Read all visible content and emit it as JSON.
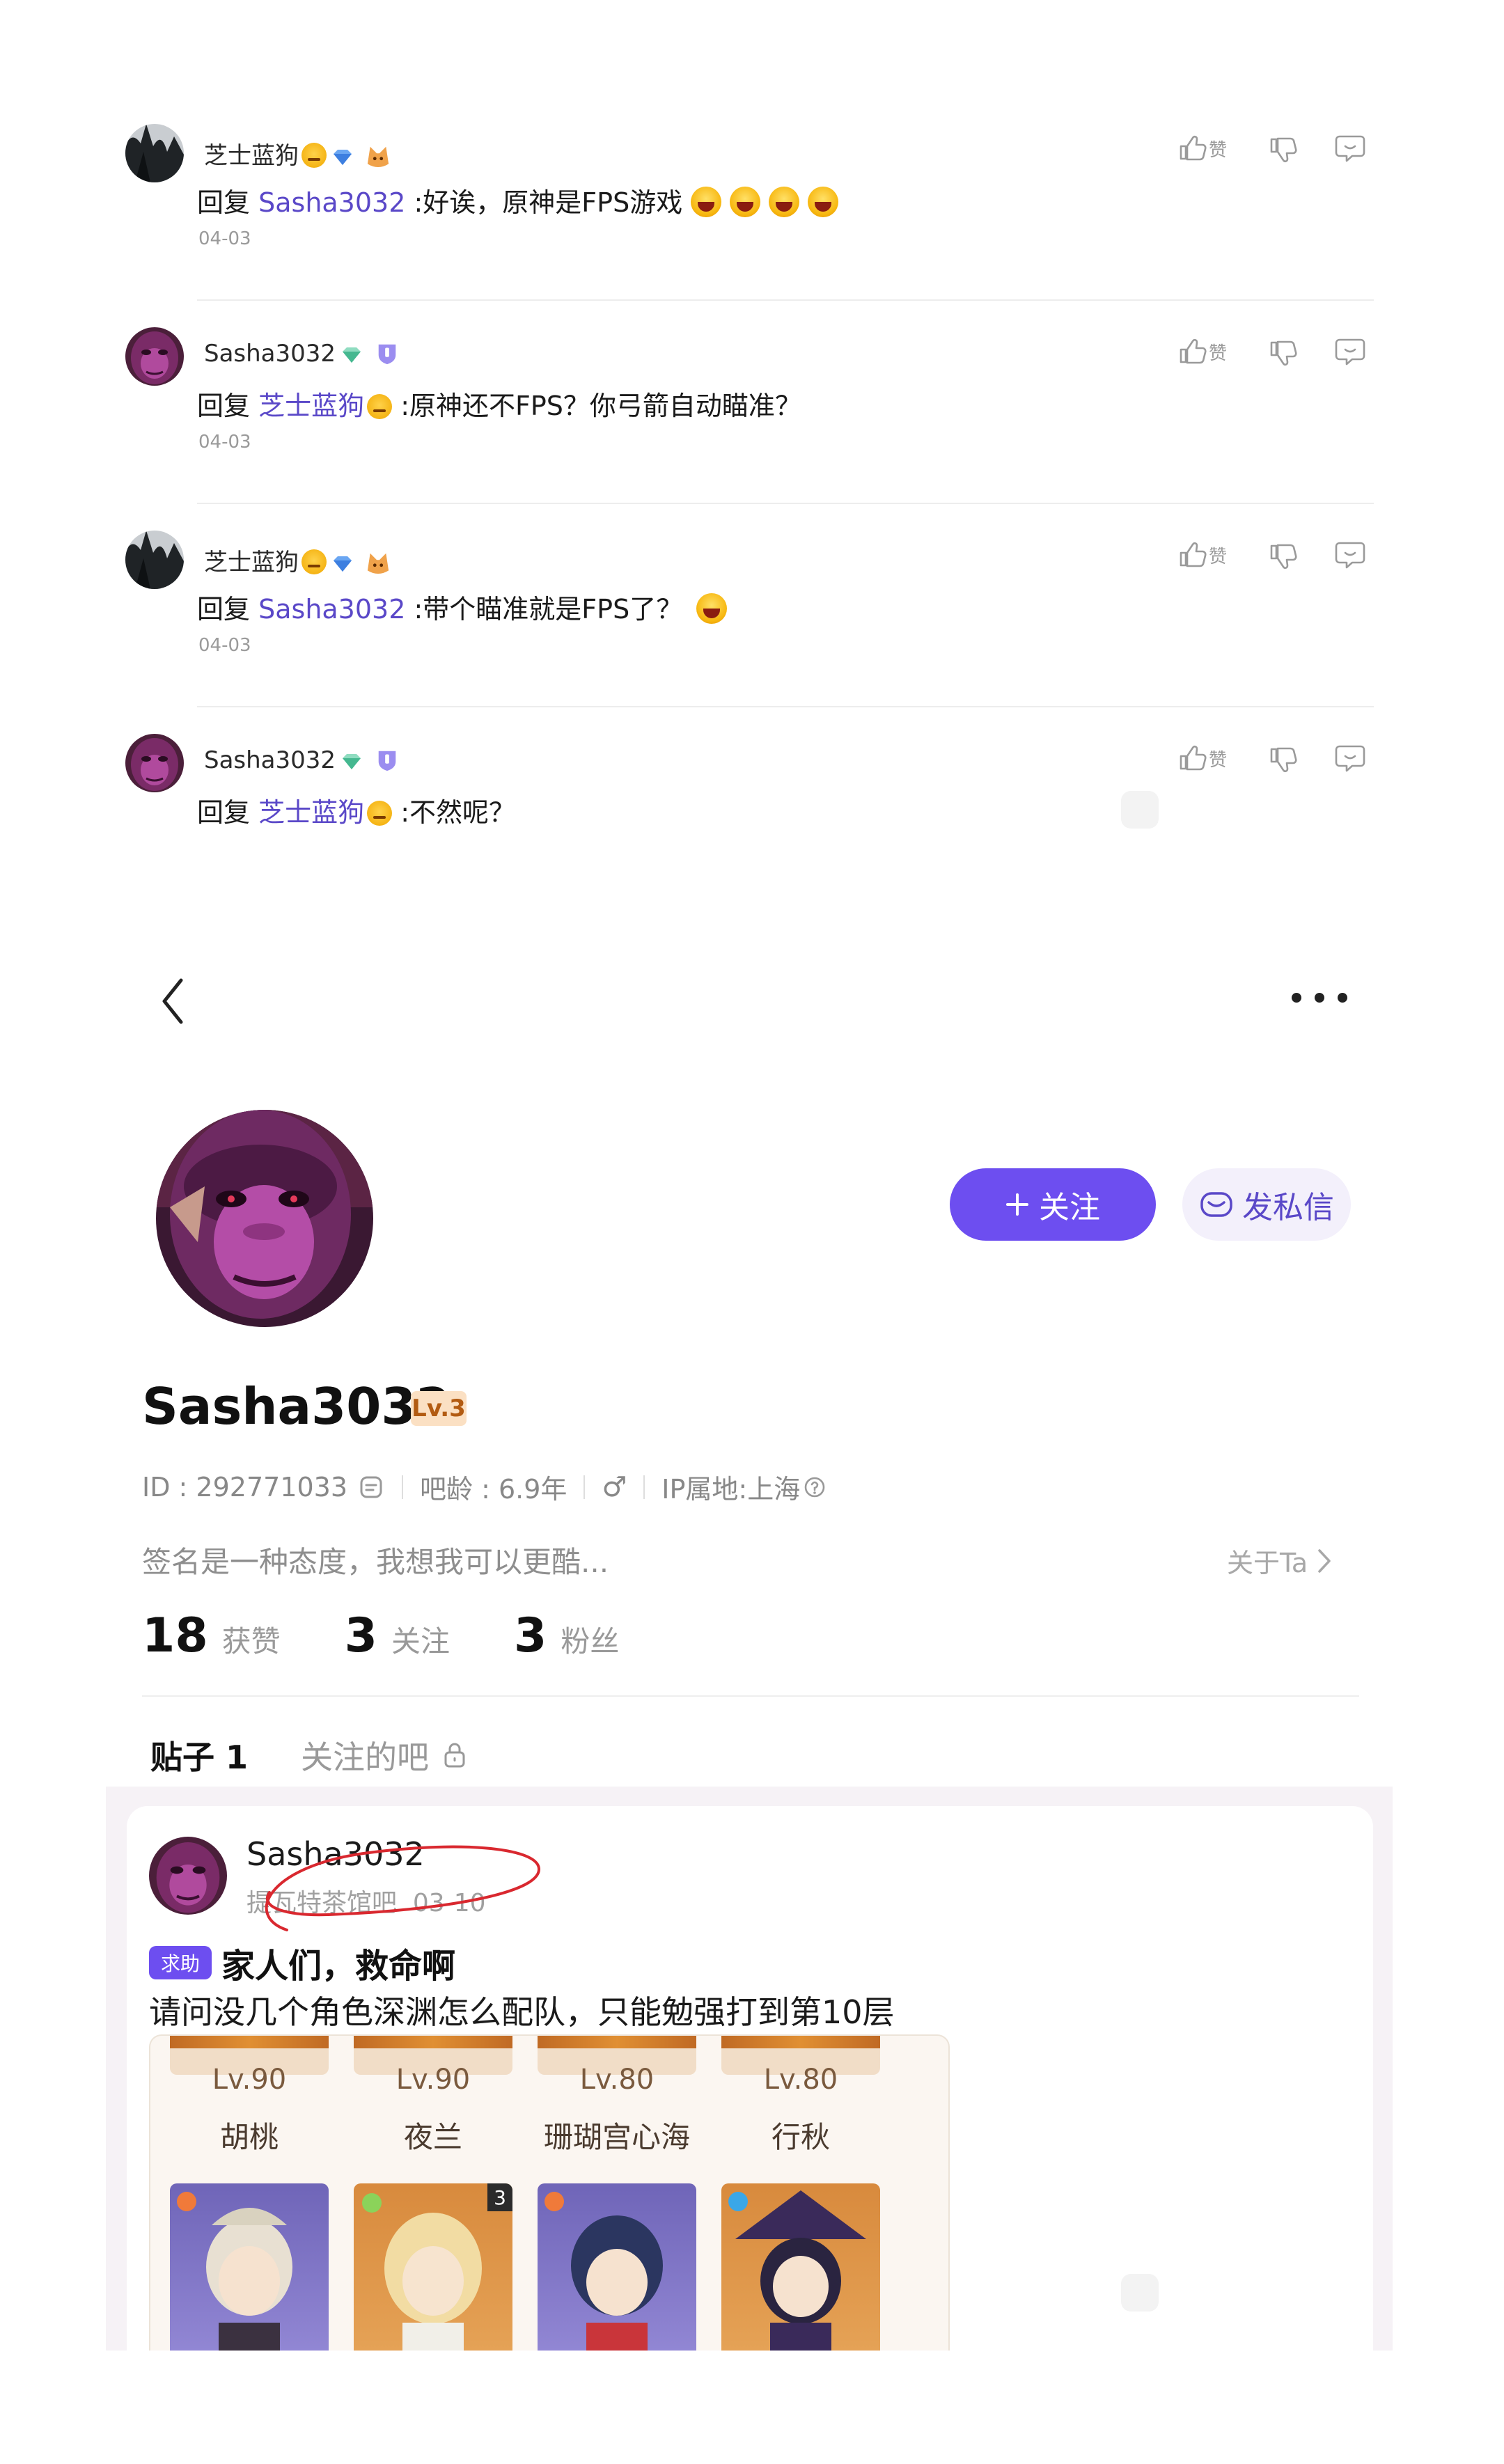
{
  "comments": [
    {
      "author": "芝士蓝狗",
      "reply_prefix": "回复",
      "reply_to": "Sasha3032",
      "text": ":好诶，原神是FPS游戏",
      "laugh_emojis": 4,
      "date": "04-03"
    },
    {
      "author": "Sasha3032",
      "reply_prefix": "回复",
      "reply_to": "芝士蓝狗",
      "text": ":原神还不FPS？你弓箭自动瞄准？",
      "date": "04-03"
    },
    {
      "author": "芝士蓝狗",
      "reply_prefix": "回复",
      "reply_to": "Sasha3032",
      "text": ":带个瞄准就是FPS了？",
      "date": "04-03"
    },
    {
      "author": "Sasha3032",
      "reply_prefix": "回复",
      "reply_to": "芝士蓝狗",
      "text": ":不然呢？"
    }
  ],
  "comment_actions": {
    "like_label": "赞"
  },
  "profile": {
    "follow_label": "关注",
    "message_label": "发私信",
    "username": "Sasha3032",
    "level": "Lv.3",
    "id_text": "ID : 292771033",
    "bar_age": "吧龄 : 6.9年",
    "gender_symbol": "♂",
    "ip_location": "IP属地:上海",
    "signature": "签名是一种态度，我想我可以更酷...",
    "about_label": "关于Ta",
    "stats": [
      {
        "value": "18",
        "label": "获赞"
      },
      {
        "value": "3",
        "label": "关注"
      },
      {
        "value": "3",
        "label": "粉丝"
      }
    ],
    "tabs": [
      {
        "label": "贴子 1"
      },
      {
        "label": "关注的吧"
      }
    ]
  },
  "post": {
    "author": "Sasha3032",
    "forum": "提瓦特茶馆吧",
    "date": "03-10",
    "tag": "求助",
    "title": "家人们，救命啊",
    "body": "请问没几个角色深渊怎么配队，只能勉强打到第10层",
    "characters": [
      {
        "level": "Lv.90",
        "name": "胡桃"
      },
      {
        "level": "Lv.90",
        "name": "夜兰"
      },
      {
        "level": "Lv.80",
        "name": "珊瑚宫心海"
      },
      {
        "level": "Lv.80",
        "name": "行秋"
      }
    ],
    "second_row_badge": "3"
  },
  "colors": {
    "accent": "#6d4ef0",
    "mention": "#5a48c8",
    "level_badge_bg": "#fbe0c3",
    "feed_bg": "#f6f2f6"
  }
}
